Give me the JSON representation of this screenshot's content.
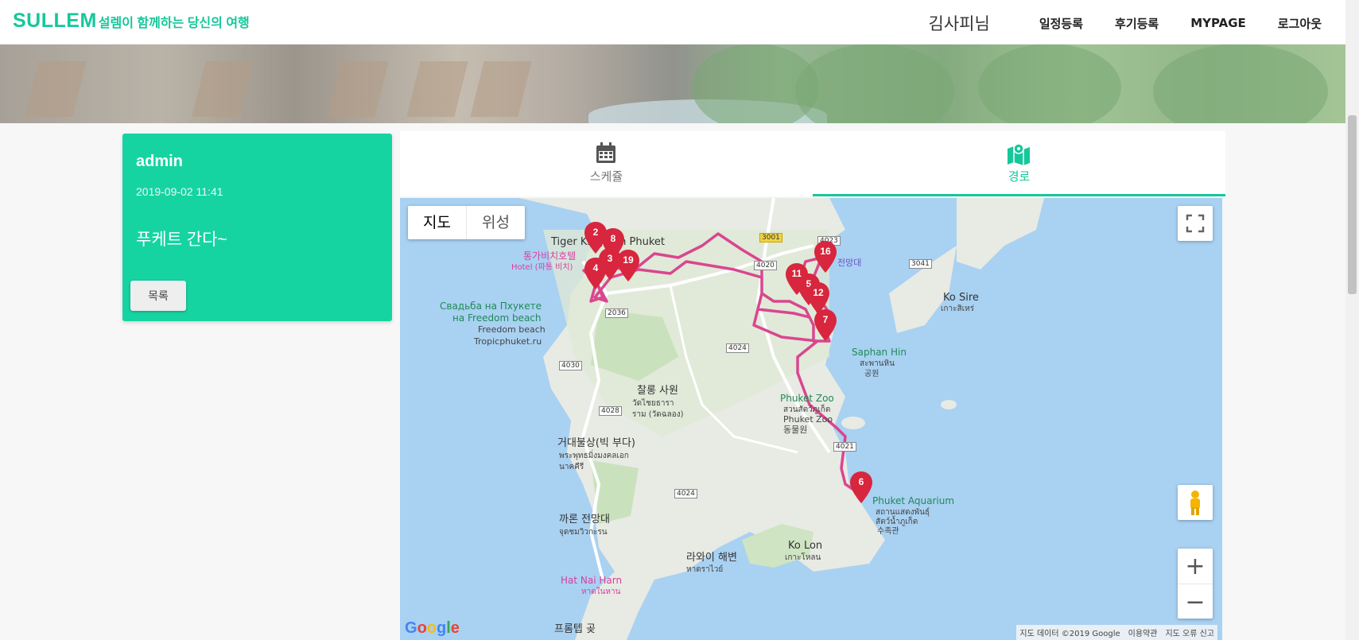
{
  "header": {
    "brand_name": "SULLEM",
    "brand_slogan": "설렘이 함께하는 당신의 여행",
    "user_name": "김사피님",
    "nav": [
      "일정등록",
      "후기등록",
      "MYPAGE",
      "로그아웃"
    ]
  },
  "post": {
    "author": "admin",
    "datetime": "2019-09-02 11:41",
    "title": "푸케트 간다~",
    "list_button": "목록"
  },
  "tabs": [
    {
      "label": "스케쥴",
      "icon": "calendar-icon",
      "active": false
    },
    {
      "label": "경로",
      "icon": "map-route-icon",
      "active": true
    }
  ],
  "map": {
    "type_buttons": [
      "지도",
      "위성"
    ],
    "active_type": "지도",
    "zoom_in": "+",
    "zoom_out": "−",
    "logo": [
      "G",
      "o",
      "o",
      "g",
      "l",
      "e"
    ],
    "attribution": [
      "지도 데이터 ©2019 Google",
      "이용약관",
      "지도 오류 신고"
    ],
    "labels": {
      "tiger": "Tiger Kingdom Phuket",
      "hotel1": "통가비치호텔",
      "hotel2": "Hotel (파통 비치)",
      "wedding1": "Свадьба на Пхукете",
      "wedding2": "на Freedom beach",
      "freedom1": "Freedom beach",
      "freedom2": "Tropicphuket.ru",
      "chalong1": "찰롱 사원",
      "chalong2": "วัดไชยธาราราม (วัดฉลอง)",
      "bigbuddha1": "거대불상(빅 부다)",
      "bigbuddha2": "พระพุทธมิ่งมงคลเอกนาคคีรี",
      "promthep1": "까론 전망대",
      "promthep2": "จุดชมวิวกะรน",
      "nai_harn": "Hat Nai Harn",
      "nai_harn_th": "หาดในหาน",
      "zoo1": "Phuket Zoo",
      "zoo2": "สวนสัตว์ภูเก็ต",
      "zoo3": "Phuket Zoo",
      "zoo4": "동물원",
      "saphan1": "Saphan Hin",
      "saphan2": "สะพานหิน",
      "saphan3": "공원",
      "aquarium1": "Phuket Aquarium",
      "aquarium2": "สถานแสดงพันธุ์",
      "aquarium3": "สัตว์น้ำภูเก็ต",
      "aquarium4": "수족관",
      "kosire1": "Ko Sire",
      "kosire2": "เกาะสิเหร่",
      "kolon1": "Ko Lon",
      "kolon2": "เกาะโหลน",
      "rawai1": "라와이 해변",
      "rawai2": "หาดราไวย์",
      "promthep3": "프롬텝 곶",
      "viewpoint": "전망대"
    },
    "roads": [
      "3001",
      "4023",
      "4020",
      "3041",
      "2036",
      "4024",
      "4030",
      "4028",
      "4024",
      "4021"
    ],
    "markers": [
      "2",
      "8",
      "3",
      "19",
      "4",
      "11",
      "16",
      "5",
      "12",
      "7",
      "6"
    ],
    "route_color": "#d9468f",
    "marker_color": "#d7263d"
  }
}
